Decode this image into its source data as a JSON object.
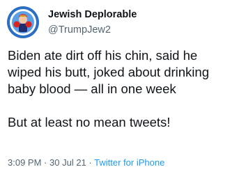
{
  "author": {
    "display_name": "Jewish Deplorable",
    "handle": "@TrumpJew2",
    "avatar_icon": "boxer-avatar-icon"
  },
  "tweet": {
    "paragraph_1": "Biden ate dirt off his chin, said he wiped his butt, joked about drinking baby blood — all in one week",
    "paragraph_2": "But at least no mean tweets!"
  },
  "meta": {
    "time": "3:09 PM",
    "separator_1": "·",
    "date": "30 Jul 21",
    "separator_2": "·",
    "source": "Twitter for iPhone"
  },
  "colors": {
    "text": "#0f1419",
    "secondary": "#536471",
    "link": "#1d9bf0",
    "avatar_ring": "#2b6fc5"
  }
}
